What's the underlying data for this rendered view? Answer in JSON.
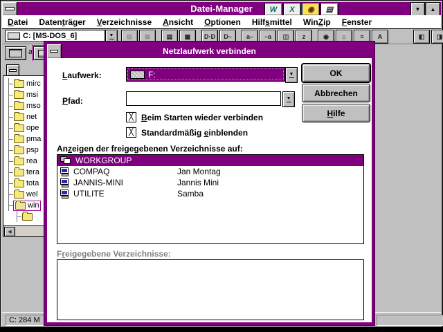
{
  "titlebar": {
    "title": "Datei-Manager",
    "office_icons": [
      {
        "name": "word-icon",
        "glyph": "W",
        "fg": "#006a6a",
        "bg": "#eeeeee"
      },
      {
        "name": "excel-icon",
        "glyph": "X",
        "fg": "#006a35",
        "bg": "#eeeeee"
      },
      {
        "name": "find-file-icon",
        "glyph": "◉",
        "fg": "#553300",
        "bg": "#ffdd55"
      },
      {
        "name": "notes-icon",
        "glyph": "▤",
        "fg": "#333333",
        "bg": "#ffffff"
      }
    ]
  },
  "menu": {
    "items": [
      {
        "id": "datei",
        "pre": "",
        "key": "D",
        "post": "atei"
      },
      {
        "id": "datentraeger",
        "pre": "Daten",
        "key": "t",
        "post": "räger"
      },
      {
        "id": "verzeichnisse",
        "pre": "",
        "key": "V",
        "post": "erzeichnisse"
      },
      {
        "id": "ansicht",
        "pre": "",
        "key": "A",
        "post": "nsicht"
      },
      {
        "id": "optionen",
        "pre": "",
        "key": "O",
        "post": "ptionen"
      },
      {
        "id": "hilfsmittel",
        "pre": "Hilf",
        "key": "s",
        "post": "mittel"
      },
      {
        "id": "winzip",
        "pre": "Win",
        "key": "Z",
        "post": "ip"
      },
      {
        "id": "fenster",
        "pre": "",
        "key": "F",
        "post": "enster"
      }
    ]
  },
  "toolbar": {
    "drive_combo_value": "C: [MS-DOS_6]",
    "buttons": [
      {
        "name": "toolbar-connect-drive-icon",
        "glyph": "⊞",
        "disabled": true
      },
      {
        "name": "toolbar-disconnect-drive-icon",
        "glyph": "⊠",
        "disabled": true
      },
      {
        "sep": true
      },
      {
        "name": "toolbar-share-icon",
        "glyph": "▤",
        "disabled": false
      },
      {
        "name": "toolbar-unshare-icon",
        "glyph": "▦",
        "disabled": false
      },
      {
        "sep": true
      },
      {
        "name": "toolbar-view-details-icon",
        "glyph": "D·D",
        "disabled": false
      },
      {
        "name": "toolbar-view-brief-icon",
        "glyph": "D–",
        "disabled": false
      },
      {
        "sep": true
      },
      {
        "name": "toolbar-sort-name-icon",
        "glyph": "a–",
        "disabled": false
      },
      {
        "name": "toolbar-sort-type-icon",
        "glyph": "–a",
        "disabled": false
      },
      {
        "name": "toolbar-sort-size-icon",
        "glyph": "◫",
        "disabled": false
      },
      {
        "name": "toolbar-sort-date-icon",
        "glyph": "z",
        "disabled": false
      },
      {
        "sep": true
      },
      {
        "name": "toolbar-search-icon",
        "glyph": "◉",
        "disabled": false
      },
      {
        "name": "toolbar-home-icon",
        "glyph": "⌂",
        "disabled": false
      },
      {
        "name": "toolbar-print-icon",
        "glyph": "≡",
        "disabled": false
      },
      {
        "name": "toolbar-font-icon",
        "glyph": "A",
        "disabled": false
      },
      {
        "gap": true
      },
      {
        "name": "toolbar-new-window-icon",
        "glyph": "◧",
        "disabled": false
      },
      {
        "name": "toolbar-exit-icon",
        "glyph": "◨",
        "disabled": false
      }
    ]
  },
  "drivebar": {
    "drives": [
      {
        "letter": "a",
        "type": "floppy",
        "selected": false
      },
      {
        "letter": "",
        "type": "hard",
        "selected": true
      }
    ]
  },
  "tree": {
    "folders": [
      {
        "label": "mirc"
      },
      {
        "label": "msi"
      },
      {
        "label": "mso"
      },
      {
        "label": "net"
      },
      {
        "label": "ope"
      },
      {
        "label": "pma"
      },
      {
        "label": "psp"
      },
      {
        "label": "rea"
      },
      {
        "label": "tera"
      },
      {
        "label": "tota"
      },
      {
        "label": "wel"
      },
      {
        "label": "win",
        "selected": true,
        "open": true
      },
      {
        "label": "",
        "child": true
      }
    ]
  },
  "status": {
    "left": "C: 284 M",
    "right": ""
  },
  "dialog": {
    "title": "Netzlaufwerk verbinden",
    "laufwerk_label": {
      "pre": "",
      "key": "L",
      "post": "aufwerk:"
    },
    "drive_value": "F:",
    "pfad_label": {
      "pre": "",
      "key": "P",
      "post": "fad:"
    },
    "pfad_value": "",
    "buttons": {
      "ok": "OK",
      "cancel": "Abbrechen",
      "help": {
        "pre": "",
        "key": "H",
        "post": "ilfe"
      }
    },
    "checkbox_reconnect": {
      "checked": true,
      "label": {
        "pre": "",
        "key": "B",
        "post": "eim Starten wieder verbinden"
      }
    },
    "checkbox_show": {
      "checked": true,
      "label": {
        "pre": "Standardmäßig ",
        "key": "e",
        "post": "inblenden"
      }
    },
    "servers_label": {
      "pre": "An",
      "key": "z",
      "post": "eigen der freigegebenen Verzeichnisse auf:"
    },
    "servers": [
      {
        "name": "WORKGROUP",
        "comment": "",
        "type": "domain",
        "selected": true
      },
      {
        "name": "COMPAQ",
        "comment": "Jan Montag",
        "type": "computer",
        "selected": false
      },
      {
        "name": "JANNIS-MINI",
        "comment": "Jannis Mini",
        "type": "computer",
        "selected": false
      },
      {
        "name": "UTILITE",
        "comment": "Samba",
        "type": "computer",
        "selected": false
      }
    ],
    "shared_label": {
      "pre": "F",
      "key": "r",
      "post": "eigegebene Verzeichnisse:"
    },
    "shared_list": []
  },
  "icons": {
    "dropdown_arrow": "▼",
    "minimize": "▼",
    "maximize": "▲",
    "scroll_left": "◀",
    "check_mark": "╳"
  },
  "colors": {
    "accent": "#800080",
    "selection": "#800080",
    "disabled_text": "#808080"
  }
}
